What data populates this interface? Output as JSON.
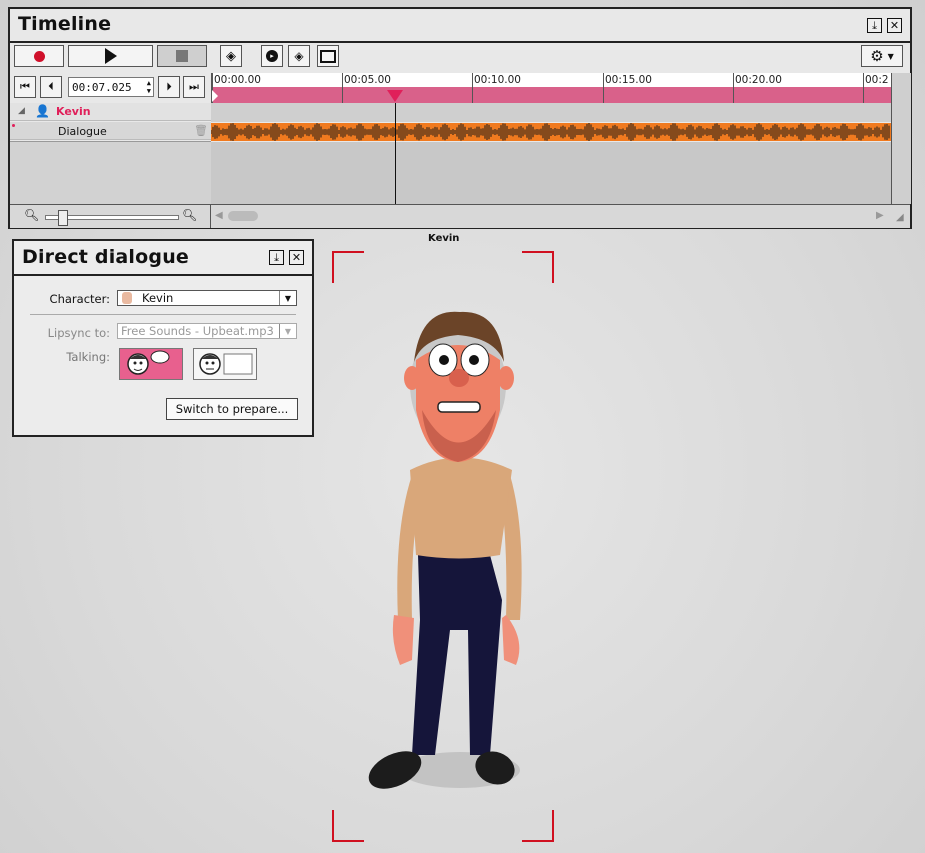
{
  "timeline": {
    "title": "Timeline",
    "time_value": "00:07.025",
    "ruler_labels": [
      "00:00.00",
      "00:05.00",
      "00:10.00",
      "00:15.00",
      "00:20.00",
      "00:2"
    ],
    "track_name": "Kevin",
    "sub_track": "Dialogue"
  },
  "dialogue_panel": {
    "title": "Direct dialogue",
    "character_label": "Character:",
    "character_value": "Kevin",
    "lipsync_label": "Lipsync to:",
    "lipsync_value": "Free Sounds - Upbeat.mp3",
    "talking_label": "Talking:",
    "switch_button": "Switch to prepare..."
  },
  "viewport": {
    "character_tag": "Kevin"
  },
  "colors": {
    "accent_pink": "#d9618a",
    "waveform": "#f07a1f",
    "frame_red": "#d01020",
    "track_name": "#e0205a"
  }
}
